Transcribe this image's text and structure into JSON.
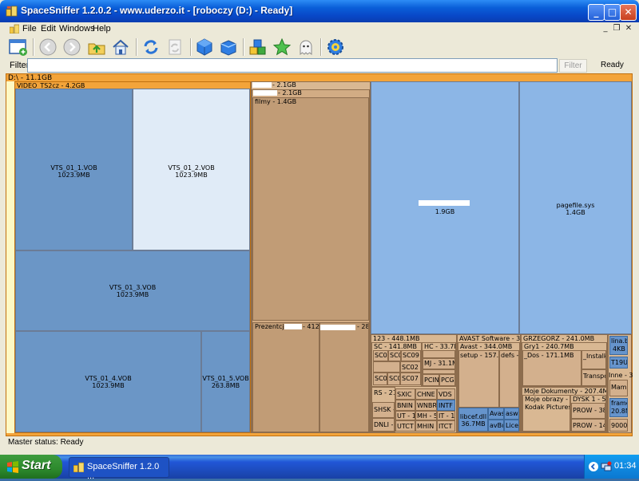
{
  "window": {
    "title": "SpaceSniffer 1.2.0.2 - www.uderzo.it - [roboczy (D:) - Ready]",
    "min_glyph": "_",
    "max_glyph": "□",
    "close_glyph": "✕"
  },
  "menu": {
    "items": [
      "File",
      "Edit",
      "Windows",
      "Help"
    ]
  },
  "toolbar": {
    "buttons": [
      "new-view",
      "back",
      "forward",
      "folder-up",
      "home",
      "refresh",
      "refresh-disabled",
      "blue-cube",
      "blue-cube-2",
      "multi-cube",
      "star",
      "ghost",
      "settings"
    ]
  },
  "filter": {
    "label": "Filter",
    "value": "",
    "button": "Filter",
    "status": "Ready"
  },
  "treemap": {
    "drive_label": "D:\\ - 11.1GB",
    "video_folder": "VIDEO_TS2cz - 4.2GB",
    "vob1_name": "VTS_01_1.VOB",
    "vob1_size": "1023.9MB",
    "vob2_name": "VTS_01_2.VOB",
    "vob2_size": "1023.9MB",
    "vob3_name": "VTS_01_3.VOB",
    "vob3_size": "1023.9MB",
    "vob4_name": "VTS_01_4.VOB",
    "vob4_size": "1023.9MB",
    "vob5_name": "VTS_01_5.VOB",
    "vob5_size": "263.8MB",
    "mid_a": "- 2.1GB",
    "mid_b": "- 2.1GB",
    "filmy": "filmy - 1.4GB",
    "prezentacje": "Prezentcje",
    "prezentacje_size": "- 412.",
    "prez_right": "- 28",
    "big_size": "1.9GB",
    "pagefile_name": "pagefile.sys",
    "pagefile_size": "1.4GB",
    "f123": "123 - 448.1MB",
    "sc": "SC - 141.8MB",
    "hc": "HC - 33.7M",
    "sc01": "SC01",
    "sc0a": "SC0",
    "sc09": "SC09 -",
    "sc02": "SC02 -",
    "mj": "MJ - 31.1M",
    "sc0b": "SC0",
    "sc0c": "SC0",
    "sc07": "SC07 -",
    "pcin": "PCIN",
    "pcg": "PCG",
    "rs": "RS - 21.",
    "sxic": "SXIC",
    "chne": "CHNE",
    "vds": "VDS",
    "shsk": "SHSK -",
    "bnin": "BNIN",
    "wnbr": "WNBR",
    "intf": "INTF",
    "ut": "UT - 11",
    "mh": "MH - 5",
    "it": "IT - 1.",
    "dnli": "DNLI -",
    "utct": "UTCT",
    "mhin": "MHIN",
    "itct": "ITCT",
    "avast_sw": "AVAST Software - 344.",
    "avast": "Avast - 344.0MB",
    "setup": "setup - 157.7M",
    "defs": "defs - 8",
    "libcef": "libcef.dll",
    "libcef_size": "36.7MB",
    "avas": "Avas",
    "asw": "aswC",
    "avbu": "avBu",
    "licen": "Licen",
    "grzegorz": "GRZEGORZ - 241.0MB",
    "gry1": "Gry1 - 240.7MB",
    "dos": "_Dos - 171.1MB",
    "instal": "_Instalki",
    "transpo": "Transpo",
    "moje_dok": "Moje Dokumenty - 207.4MB",
    "moje_obr": "Moje obrazy - 121",
    "dysk": "DYSK 1 - 57",
    "kodak": "Kodak Pictures -",
    "prow38": "PROW - 38",
    "prow14": "PROW - 14",
    "lina": "lina.br",
    "lina_size": "4KB",
    "t19": "T19Ut",
    "inne": "Inne - 3",
    "mamb": "Mamb",
    "framew": "framew",
    "framew_size": "20.8ME",
    "n90000": "90000"
  },
  "status": {
    "text": "Master status: Ready"
  },
  "taskbar": {
    "start": "Start",
    "task": "SpaceSniffer 1.2.0 ...",
    "clock": "01:34"
  }
}
